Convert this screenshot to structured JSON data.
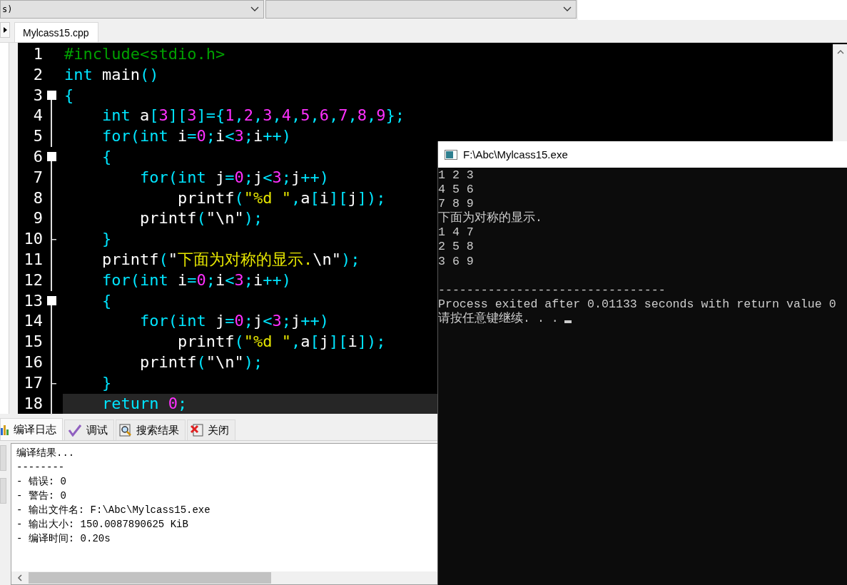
{
  "toolbar": {
    "dropdowns": [
      {
        "kind": "text",
        "value": "s)"
      },
      {
        "kind": "blank"
      }
    ]
  },
  "editor_tabs": [
    {
      "label": "Mylcass15.cpp",
      "selected": true
    }
  ],
  "code_lines": [
    {
      "number": "1",
      "kind": "none",
      "current": false,
      "tokens": [
        {
          "t": "#include<stdio.h>",
          "kind": "pre"
        }
      ]
    },
    {
      "number": "2",
      "kind": "none",
      "current": false,
      "tokens": [
        {
          "t": "int",
          "kind": "kw"
        },
        {
          "t": " main",
          "kind": "id"
        },
        {
          "t": "()",
          "kind": "punct"
        }
      ]
    },
    {
      "number": "3",
      "kind": "start",
      "current": false,
      "tokens": [
        {
          "t": "{",
          "kind": "punct"
        }
      ]
    },
    {
      "number": "4",
      "kind": "line",
      "current": false,
      "tokens": [
        {
          "t": "    int",
          "kind": "kw"
        },
        {
          "t": " a",
          "kind": "id"
        },
        {
          "t": "[",
          "kind": "punct"
        },
        {
          "t": "3",
          "kind": "num"
        },
        {
          "t": "][",
          "kind": "punct"
        },
        {
          "t": "3",
          "kind": "num"
        },
        {
          "t": "]={",
          "kind": "punct"
        },
        {
          "t": "1",
          "kind": "num"
        },
        {
          "t": ",",
          "kind": "punct"
        },
        {
          "t": "2",
          "kind": "num"
        },
        {
          "t": ",",
          "kind": "punct"
        },
        {
          "t": "3",
          "kind": "num"
        },
        {
          "t": ",",
          "kind": "punct"
        },
        {
          "t": "4",
          "kind": "num"
        },
        {
          "t": ",",
          "kind": "punct"
        },
        {
          "t": "5",
          "kind": "num"
        },
        {
          "t": ",",
          "kind": "punct"
        },
        {
          "t": "6",
          "kind": "num"
        },
        {
          "t": ",",
          "kind": "punct"
        },
        {
          "t": "7",
          "kind": "num"
        },
        {
          "t": ",",
          "kind": "punct"
        },
        {
          "t": "8",
          "kind": "num"
        },
        {
          "t": ",",
          "kind": "punct"
        },
        {
          "t": "9",
          "kind": "num"
        },
        {
          "t": "};",
          "kind": "punct"
        }
      ]
    },
    {
      "number": "5",
      "kind": "line",
      "current": false,
      "tokens": [
        {
          "t": "    for",
          "kind": "kw"
        },
        {
          "t": "(",
          "kind": "punct"
        },
        {
          "t": "int",
          "kind": "kw"
        },
        {
          "t": " i",
          "kind": "id"
        },
        {
          "t": "=",
          "kind": "punct"
        },
        {
          "t": "0",
          "kind": "num"
        },
        {
          "t": ";",
          "kind": "punct"
        },
        {
          "t": "i",
          "kind": "id"
        },
        {
          "t": "<",
          "kind": "punct"
        },
        {
          "t": "3",
          "kind": "num"
        },
        {
          "t": ";",
          "kind": "punct"
        },
        {
          "t": "i",
          "kind": "id"
        },
        {
          "t": "++)",
          "kind": "punct"
        }
      ]
    },
    {
      "number": "6",
      "kind": "start",
      "current": false,
      "tokens": [
        {
          "t": "    {",
          "kind": "punct"
        }
      ]
    },
    {
      "number": "7",
      "kind": "line",
      "current": false,
      "tokens": [
        {
          "t": "        for",
          "kind": "kw"
        },
        {
          "t": "(",
          "kind": "punct"
        },
        {
          "t": "int",
          "kind": "kw"
        },
        {
          "t": " j",
          "kind": "id"
        },
        {
          "t": "=",
          "kind": "punct"
        },
        {
          "t": "0",
          "kind": "num"
        },
        {
          "t": ";",
          "kind": "punct"
        },
        {
          "t": "j",
          "kind": "id"
        },
        {
          "t": "<",
          "kind": "punct"
        },
        {
          "t": "3",
          "kind": "num"
        },
        {
          "t": ";",
          "kind": "punct"
        },
        {
          "t": "j",
          "kind": "id"
        },
        {
          "t": "++)",
          "kind": "punct"
        }
      ]
    },
    {
      "number": "8",
      "kind": "line",
      "current": false,
      "tokens": [
        {
          "t": "            printf",
          "kind": "id"
        },
        {
          "t": "(",
          "kind": "punct"
        },
        {
          "t": "\"%d \"",
          "kind": "str"
        },
        {
          "t": ",",
          "kind": "punct"
        },
        {
          "t": "a",
          "kind": "id"
        },
        {
          "t": "[",
          "kind": "punct"
        },
        {
          "t": "i",
          "kind": "id"
        },
        {
          "t": "][",
          "kind": "punct"
        },
        {
          "t": "j",
          "kind": "id"
        },
        {
          "t": "]);",
          "kind": "punct"
        }
      ]
    },
    {
      "number": "9",
      "kind": "line",
      "current": false,
      "tokens": [
        {
          "t": "        printf",
          "kind": "id"
        },
        {
          "t": "(",
          "kind": "punct"
        },
        {
          "t": "\"\\n\"",
          "kind": "id"
        },
        {
          "t": ");",
          "kind": "punct"
        }
      ]
    },
    {
      "number": "10",
      "kind": "end",
      "current": false,
      "tokens": [
        {
          "t": "    }",
          "kind": "punct"
        }
      ]
    },
    {
      "number": "11",
      "kind": "line",
      "current": false,
      "tokens": [
        {
          "t": "    printf",
          "kind": "id"
        },
        {
          "t": "(",
          "kind": "punct"
        },
        {
          "t": "\"",
          "kind": "id"
        },
        {
          "t": "下面为对称的显示.",
          "kind": "str"
        },
        {
          "t": "\\n\"",
          "kind": "id"
        },
        {
          "t": ");",
          "kind": "punct"
        }
      ]
    },
    {
      "number": "12",
      "kind": "line",
      "current": false,
      "tokens": [
        {
          "t": "    for",
          "kind": "kw"
        },
        {
          "t": "(",
          "kind": "punct"
        },
        {
          "t": "int",
          "kind": "kw"
        },
        {
          "t": " i",
          "kind": "id"
        },
        {
          "t": "=",
          "kind": "punct"
        },
        {
          "t": "0",
          "kind": "num"
        },
        {
          "t": ";",
          "kind": "punct"
        },
        {
          "t": "i",
          "kind": "id"
        },
        {
          "t": "<",
          "kind": "punct"
        },
        {
          "t": "3",
          "kind": "num"
        },
        {
          "t": ";",
          "kind": "punct"
        },
        {
          "t": "i",
          "kind": "id"
        },
        {
          "t": "++)",
          "kind": "punct"
        }
      ]
    },
    {
      "number": "13",
      "kind": "start",
      "current": false,
      "tokens": [
        {
          "t": "    {",
          "kind": "punct"
        }
      ]
    },
    {
      "number": "14",
      "kind": "line",
      "current": false,
      "tokens": [
        {
          "t": "        for",
          "kind": "kw"
        },
        {
          "t": "(",
          "kind": "punct"
        },
        {
          "t": "int",
          "kind": "kw"
        },
        {
          "t": " j",
          "kind": "id"
        },
        {
          "t": "=",
          "kind": "punct"
        },
        {
          "t": "0",
          "kind": "num"
        },
        {
          "t": ";",
          "kind": "punct"
        },
        {
          "t": "j",
          "kind": "id"
        },
        {
          "t": "<",
          "kind": "punct"
        },
        {
          "t": "3",
          "kind": "num"
        },
        {
          "t": ";",
          "kind": "punct"
        },
        {
          "t": "j",
          "kind": "id"
        },
        {
          "t": "++)",
          "kind": "punct"
        }
      ]
    },
    {
      "number": "15",
      "kind": "line",
      "current": false,
      "tokens": [
        {
          "t": "            printf",
          "kind": "id"
        },
        {
          "t": "(",
          "kind": "punct"
        },
        {
          "t": "\"%d \"",
          "kind": "str"
        },
        {
          "t": ",",
          "kind": "punct"
        },
        {
          "t": "a",
          "kind": "id"
        },
        {
          "t": "[",
          "kind": "punct"
        },
        {
          "t": "j",
          "kind": "id"
        },
        {
          "t": "][",
          "kind": "punct"
        },
        {
          "t": "i",
          "kind": "id"
        },
        {
          "t": "]);",
          "kind": "punct"
        }
      ]
    },
    {
      "number": "16",
      "kind": "line",
      "current": false,
      "tokens": [
        {
          "t": "        printf",
          "kind": "id"
        },
        {
          "t": "(",
          "kind": "punct"
        },
        {
          "t": "\"\\n\"",
          "kind": "id"
        },
        {
          "t": ");",
          "kind": "punct"
        }
      ]
    },
    {
      "number": "17",
      "kind": "end",
      "current": false,
      "tokens": [
        {
          "t": "    }",
          "kind": "punct"
        }
      ]
    },
    {
      "number": "18",
      "kind": "line",
      "current": true,
      "tokens": [
        {
          "t": "    return ",
          "kind": "kw"
        },
        {
          "t": "0",
          "kind": "num"
        },
        {
          "t": ";",
          "kind": "punct"
        }
      ]
    }
  ],
  "bottom_tabs": [
    {
      "label": "编译日志",
      "selected": true
    },
    {
      "label": "调试",
      "selected": false
    },
    {
      "label": "搜索结果",
      "selected": false
    },
    {
      "label": "关闭",
      "selected": false
    }
  ],
  "compile_log": [
    "编译结果...",
    "--------",
    "- 错误: 0",
    "- 警告: 0",
    "- 输出文件名: F:\\Abc\\Mylcass15.exe",
    "- 输出大小: 150.0087890625 KiB",
    "- 编译时间: 0.20s"
  ],
  "console": {
    "title": "F:\\Abc\\Mylcass15.exe",
    "output": [
      "1 2 3",
      "4 5 6",
      "7 8 9",
      "下面为对称的显示.",
      "1 4 7",
      "2 5 8",
      "3 6 9"
    ],
    "separator": "--------------------------------",
    "status": [
      "Process exited after 0.01133 seconds with return value 0",
      "请按任意键继续. . ."
    ]
  }
}
